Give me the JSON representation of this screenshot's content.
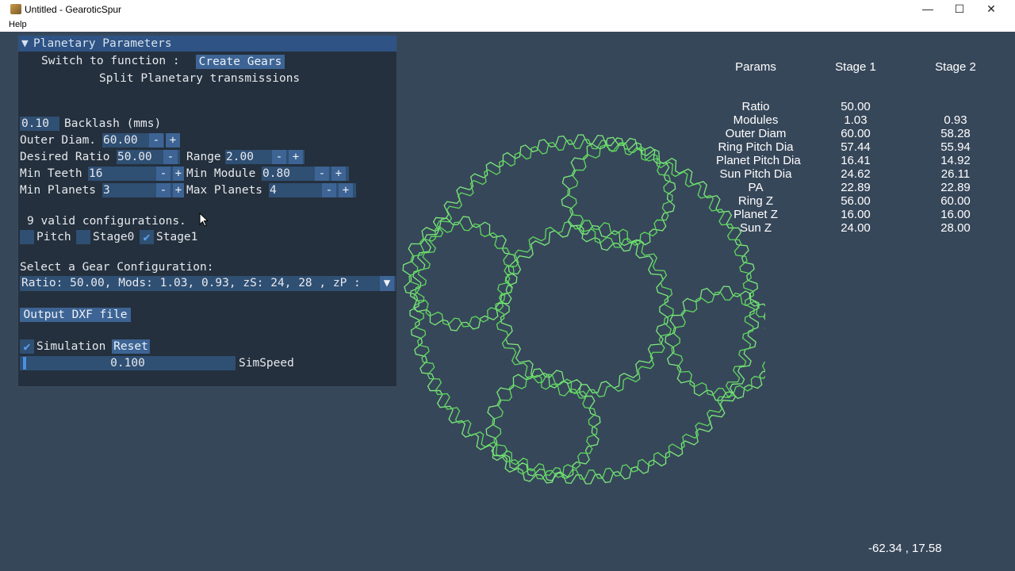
{
  "window": {
    "title": "Untitled - GearoticSpur",
    "minimize_glyph": "—",
    "maximize_glyph": "☐",
    "close_glyph": "✕"
  },
  "menu": {
    "help": "Help"
  },
  "panel": {
    "header": "Planetary Parameters",
    "collapse_glyph": "▼",
    "switch_label": "Switch to function :",
    "create_gears_button": "Create Gears",
    "subtitle": "Split Planetary transmissions",
    "backlash": {
      "value": "0.10",
      "label": "Backlash (mms)"
    },
    "outer_diam": {
      "label": "Outer Diam.",
      "value": "60.00"
    },
    "desired_ratio": {
      "label": "Desired Ratio",
      "value": "50.00"
    },
    "range": {
      "label": "Range",
      "value": "2.00"
    },
    "min_teeth": {
      "label": "Min Teeth",
      "value": "16"
    },
    "min_module": {
      "label": "Min Module",
      "value": "0.80"
    },
    "min_planets": {
      "label": "Min Planets",
      "value": "3"
    },
    "max_planets": {
      "label": "Max Planets",
      "value": "4"
    },
    "minus": "-",
    "plus": "+",
    "valid_configs": "9 valid configurations.",
    "checkboxes": {
      "pitch": "Pitch",
      "stage0": "Stage0",
      "stage1": "Stage1",
      "check_glyph": "✔"
    },
    "select_label": "Select a Gear Configuration:",
    "config_value": "Ratio: 50.00, Mods: 1.03, 0.93, zS: 24, 28 , zP :",
    "dropdown_glyph": "▼",
    "output_dxf": "Output DXF file",
    "simulation_label": "Simulation",
    "reset_button": "Reset",
    "simspeed": {
      "value": "0.100",
      "label": "SimSpeed",
      "fraction": 0.01
    }
  },
  "params_table": {
    "headers": [
      "Params",
      "Stage 1",
      "Stage 2"
    ],
    "rows": [
      {
        "name": "Ratio",
        "s1": "50.00",
        "s2": ""
      },
      {
        "name": "Modules",
        "s1": "1.03",
        "s2": "0.93"
      },
      {
        "name": "Outer Diam",
        "s1": "60.00",
        "s2": "58.28"
      },
      {
        "name": "Ring Pitch Dia",
        "s1": "57.44",
        "s2": "55.94"
      },
      {
        "name": "Planet Pitch Dia",
        "s1": "16.41",
        "s2": "14.92"
      },
      {
        "name": "Sun Pitch Dia",
        "s1": "24.62",
        "s2": "26.11"
      },
      {
        "name": "PA",
        "s1": "22.89",
        "s2": "22.89"
      },
      {
        "name": "Ring Z",
        "s1": "56.00",
        "s2": "60.00"
      },
      {
        "name": "Planet Z",
        "s1": "16.00",
        "s2": "16.00"
      },
      {
        "name": "Sun Z",
        "s1": "24.00",
        "s2": "28.00"
      }
    ]
  },
  "coords": "-62.34 , 17.58",
  "colors": {
    "gear_stage1": "#7CE87C",
    "gear_stage2": "#5FD85F",
    "background": "#37475a",
    "panel": "#24303d"
  }
}
